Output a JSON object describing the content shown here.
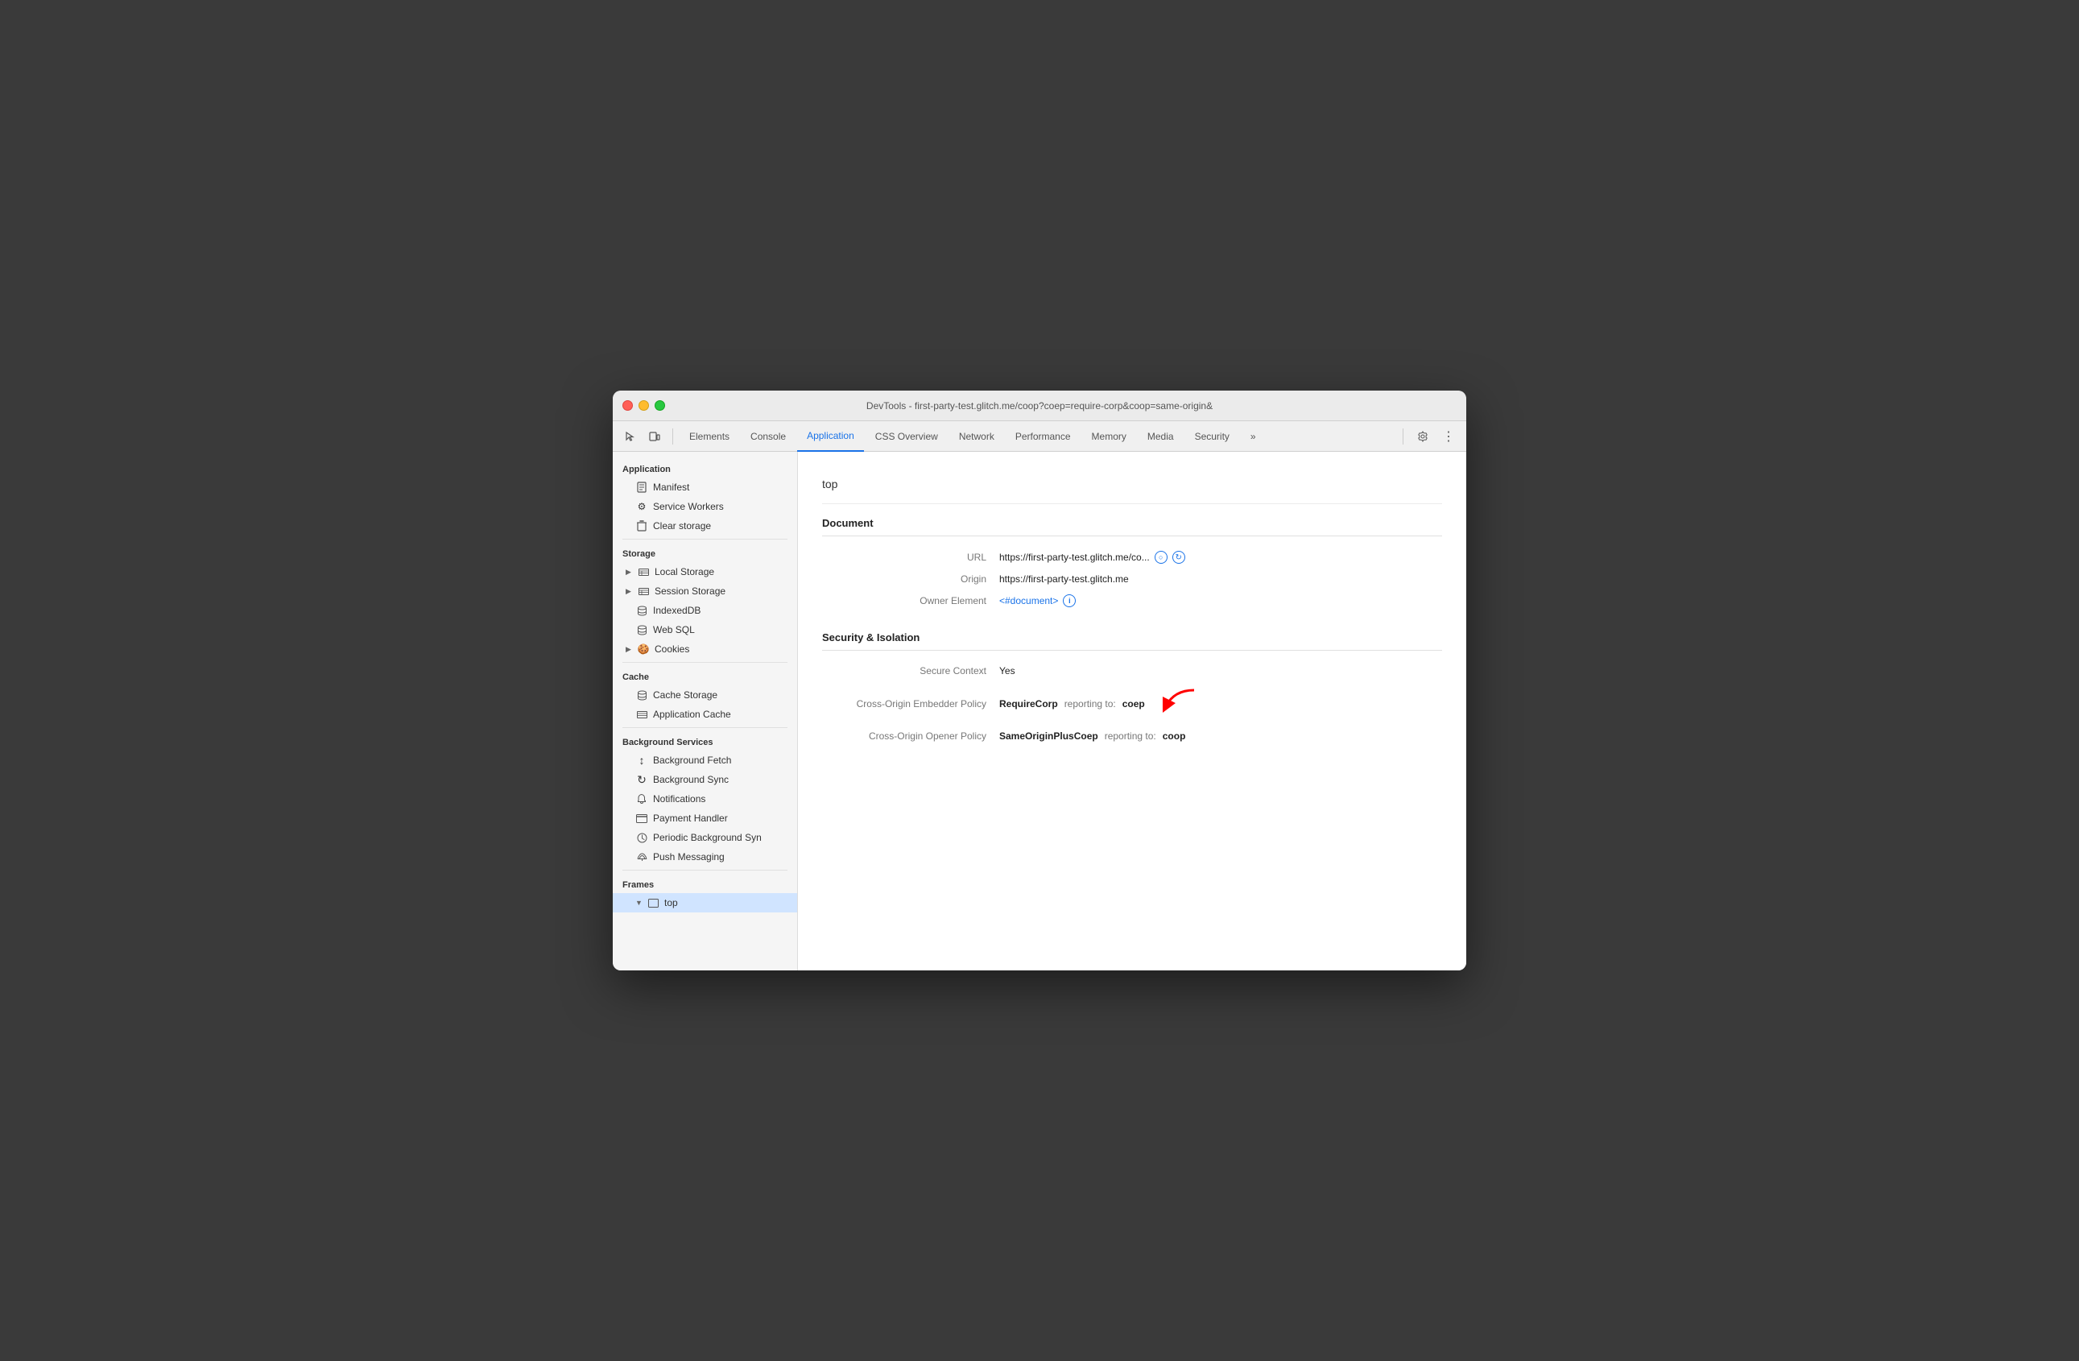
{
  "window": {
    "title": "DevTools - first-party-test.glitch.me/coop?coep=require-corp&coop=same-origin&"
  },
  "toolbar": {
    "tabs": [
      {
        "id": "elements",
        "label": "Elements",
        "active": false
      },
      {
        "id": "console",
        "label": "Console",
        "active": false
      },
      {
        "id": "application",
        "label": "Application",
        "active": true
      },
      {
        "id": "css-overview",
        "label": "CSS Overview",
        "active": false
      },
      {
        "id": "network",
        "label": "Network",
        "active": false
      },
      {
        "id": "performance",
        "label": "Performance",
        "active": false
      },
      {
        "id": "memory",
        "label": "Memory",
        "active": false
      },
      {
        "id": "media",
        "label": "Media",
        "active": false
      },
      {
        "id": "security",
        "label": "Security",
        "active": false
      },
      {
        "id": "more",
        "label": "»",
        "active": false
      }
    ]
  },
  "sidebar": {
    "sections": [
      {
        "id": "application",
        "label": "Application",
        "items": [
          {
            "id": "manifest",
            "label": "Manifest",
            "icon": "📄",
            "indent": true
          },
          {
            "id": "service-workers",
            "label": "Service Workers",
            "icon": "⚙",
            "indent": true
          },
          {
            "id": "clear-storage",
            "label": "Clear storage",
            "icon": "🗑",
            "indent": true
          }
        ]
      },
      {
        "id": "storage",
        "label": "Storage",
        "items": [
          {
            "id": "local-storage",
            "label": "Local Storage",
            "icon": "▶",
            "hasExpand": true,
            "indent": true
          },
          {
            "id": "session-storage",
            "label": "Session Storage",
            "icon": "▶",
            "hasExpand": true,
            "indent": true
          },
          {
            "id": "indexeddb",
            "label": "IndexedDB",
            "icon": "db",
            "indent": true
          },
          {
            "id": "web-sql",
            "label": "Web SQL",
            "icon": "db",
            "indent": true
          },
          {
            "id": "cookies",
            "label": "Cookies",
            "icon": "▶",
            "hasExpand": true,
            "indent": true
          }
        ]
      },
      {
        "id": "cache",
        "label": "Cache",
        "items": [
          {
            "id": "cache-storage",
            "label": "Cache Storage",
            "icon": "db",
            "indent": true
          },
          {
            "id": "application-cache",
            "label": "Application Cache",
            "icon": "grid",
            "indent": true
          }
        ]
      },
      {
        "id": "background-services",
        "label": "Background Services",
        "items": [
          {
            "id": "background-fetch",
            "label": "Background Fetch",
            "icon": "↕",
            "indent": true
          },
          {
            "id": "background-sync",
            "label": "Background Sync",
            "icon": "↻",
            "indent": true
          },
          {
            "id": "notifications",
            "label": "Notifications",
            "icon": "🔔",
            "indent": true
          },
          {
            "id": "payment-handler",
            "label": "Payment Handler",
            "icon": "▭",
            "indent": true
          },
          {
            "id": "periodic-background-sync",
            "label": "Periodic Background Syn",
            "icon": "⏱",
            "indent": true
          },
          {
            "id": "push-messaging",
            "label": "Push Messaging",
            "icon": "☁",
            "indent": true
          }
        ]
      },
      {
        "id": "frames",
        "label": "Frames",
        "items": [
          {
            "id": "top",
            "label": "top",
            "icon": "▼",
            "hasExpand": true,
            "indent": true
          }
        ]
      }
    ]
  },
  "content": {
    "page_title": "top",
    "sections": [
      {
        "id": "document",
        "header": "Document",
        "fields": [
          {
            "id": "url",
            "label": "URL",
            "value": "https://first-party-test.glitch.me/co...",
            "has_icons": true
          },
          {
            "id": "origin",
            "label": "Origin",
            "value": "https://first-party-test.glitch.me"
          },
          {
            "id": "owner-element",
            "label": "Owner Element",
            "value": "<#document>",
            "is_link": true,
            "has_circle_icon": true
          }
        ]
      },
      {
        "id": "security-isolation",
        "header": "Security & Isolation",
        "fields": [
          {
            "id": "secure-context",
            "label": "Secure Context",
            "value": "Yes"
          },
          {
            "id": "coep",
            "label": "Cross-Origin Embedder Policy",
            "policy_value": "RequireCorp",
            "reporting_text": "reporting to:",
            "reporting_value": "coep",
            "has_red_arrow": true
          },
          {
            "id": "coop",
            "label": "Cross-Origin Opener Policy",
            "policy_value": "SameOriginPlusCoep",
            "reporting_text": "reporting to:",
            "reporting_value": "coop"
          }
        ]
      }
    ]
  },
  "icons": {
    "cursor": "⬚",
    "device": "▣",
    "gear": "⚙",
    "settings": "⚙",
    "more-vert": "⋮"
  }
}
